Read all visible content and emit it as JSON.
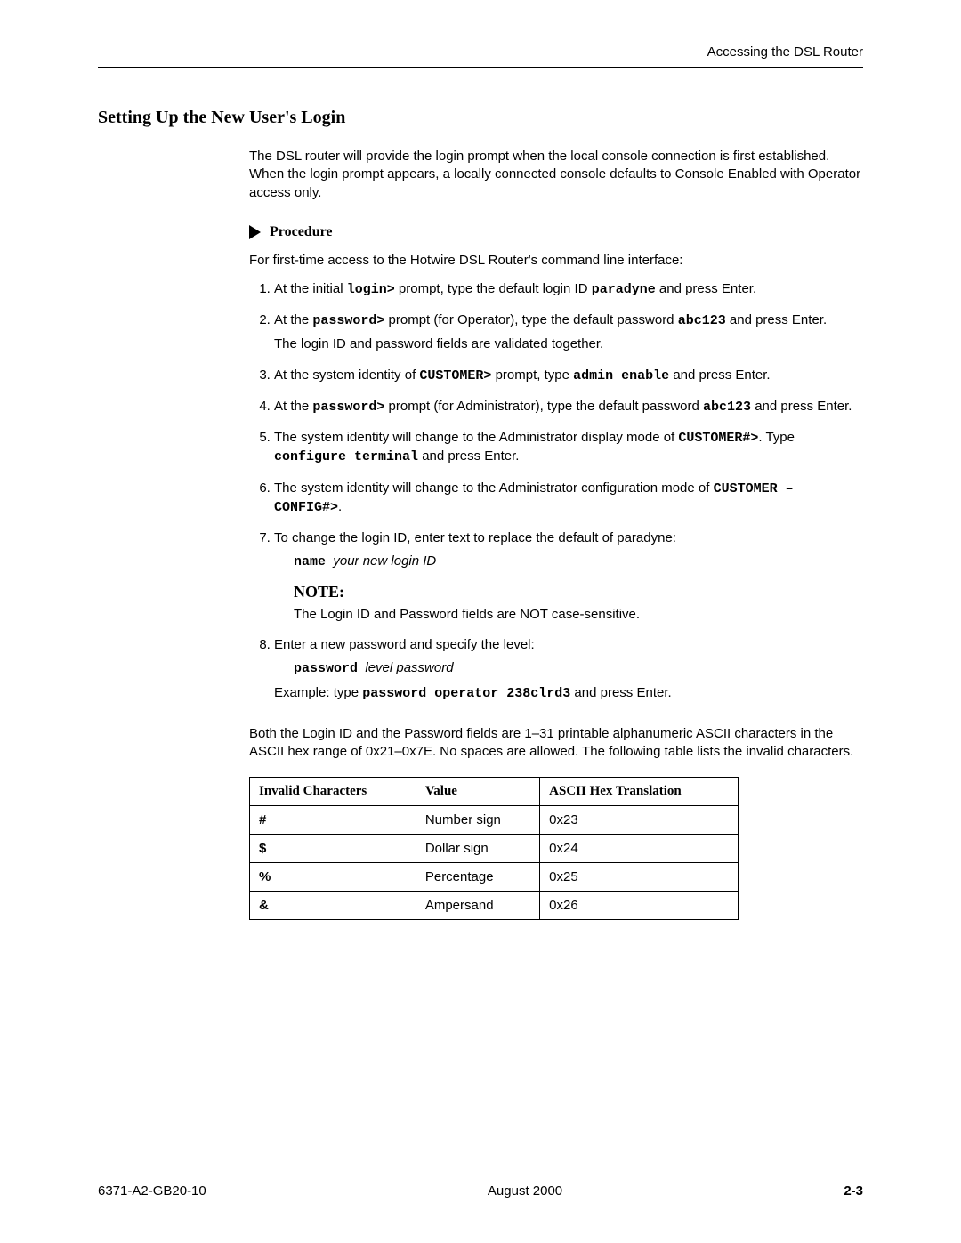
{
  "header": {
    "chapter_title": "Accessing the DSL Router"
  },
  "section": {
    "heading": "Setting Up the New User's Login",
    "intro": "The DSL router will provide the login prompt when the local console connection is first established. When the login prompt appears, a locally connected console defaults to Console Enabled with Operator access only."
  },
  "procedure": {
    "label": "Procedure",
    "intro": "For first-time access to the Hotwire DSL Router's command line interface:",
    "steps": {
      "s1": {
        "pre": "At the initial ",
        "code1": "login>",
        "mid": " prompt, type the default login ID ",
        "code2": "paradyne",
        "post": " and press Enter."
      },
      "s2": {
        "pre": "At the ",
        "code1": "password>",
        "mid": " prompt (for Operator), type the default password ",
        "code2": "abc123",
        "post": " and press Enter.",
        "sub": "The login ID and password fields are validated together."
      },
      "s3": {
        "pre": "At the system identity of ",
        "code1": "CUSTOMER>",
        "mid": " prompt, type ",
        "code2": "admin enable",
        "post": " and press Enter."
      },
      "s4": {
        "pre": "At the ",
        "code1": "password>",
        "mid": " prompt (for Administrator), type the default password ",
        "code2": "abc123",
        "post": " and press Enter."
      },
      "s5": {
        "pre": "The system identity will change to the Administrator display mode of ",
        "code1": "CUSTOMER#>",
        "mid": ". Type ",
        "code2": "configure terminal",
        "post": " and press Enter."
      },
      "s6": {
        "pre": "The system identity will change to the Administrator configuration mode of ",
        "code1": "CUSTOMER – CONFIG#>",
        "post": "."
      },
      "s7": {
        "text": "To change the login ID, enter text to replace the default of paradyne:",
        "ex_code": "name",
        "ex_italic": "your new login ID"
      },
      "note": {
        "heading": "NOTE:",
        "body": "The Login ID and Password fields are NOT case-sensitive."
      },
      "s8": {
        "text": "Enter a new password and specify the level:",
        "ex_code": "password",
        "ex_italic": "level password",
        "example_pre": "Example: type ",
        "example_code": "password operator 238clrd3",
        "example_post": "  and press Enter."
      }
    },
    "after_steps": "Both the Login ID and the Password fields are 1–31 printable alphanumeric ASCII characters in the ASCII hex range of 0x21–0x7E. No spaces are allowed. The following table lists the invalid characters."
  },
  "table": {
    "headers": {
      "c1": "Invalid Characters",
      "c2": "Value",
      "c3": "ASCII Hex Translation"
    },
    "rows": [
      {
        "c1": "#",
        "c2": "Number sign",
        "c3": "0x23"
      },
      {
        "c1": "$",
        "c2": "Dollar sign",
        "c3": "0x24"
      },
      {
        "c1": "%",
        "c2": "Percentage",
        "c3": "0x25"
      },
      {
        "c1": "&",
        "c2": "Ampersand",
        "c3": "0x26"
      }
    ]
  },
  "footer": {
    "doc_id": "6371-A2-GB20-10",
    "date": "August 2000",
    "page": "2-3"
  }
}
